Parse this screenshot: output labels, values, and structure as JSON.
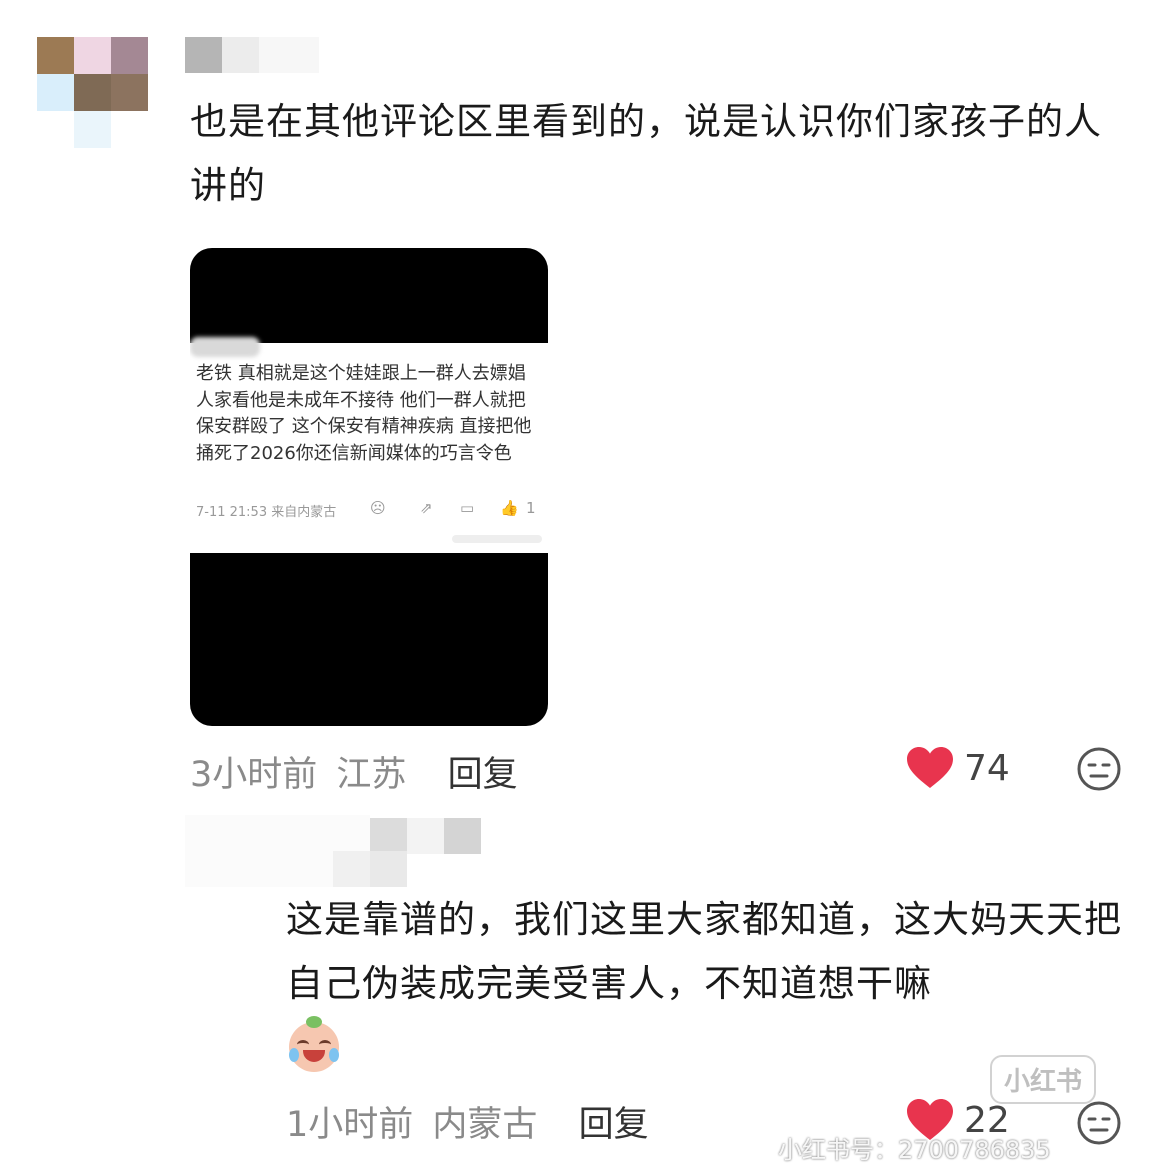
{
  "comment1": {
    "text": "也是在其他评论区里看到的，说是认识你们家孩子的人讲的",
    "time": "3小时前",
    "location": "江苏",
    "reply_label": "回复",
    "likes": "74"
  },
  "embedded": {
    "text": "老铁 真相就是这个娃娃跟上一群人去嫖娼 人家看他是未成年不接待 他们一群人就把保安群殴了 这个保安有精神疾病 直接把他捅死了2026你还信新闻媒体的巧言令色",
    "meta": "7-11 21:53 来自内蒙古",
    "like_count": "1"
  },
  "comment2": {
    "text": "这是靠谱的，我们这里大家都知道，这大妈天天把自己伪装成完美受害人，不知道想干嘛",
    "time": "1小时前",
    "location": "内蒙古",
    "reply_label": "回复",
    "likes": "22"
  },
  "watermark": {
    "brand": "小红书",
    "user_id": "小红书号：2700786835"
  },
  "colors": {
    "like": "#e8344e",
    "meta": "#8a8a8a"
  }
}
